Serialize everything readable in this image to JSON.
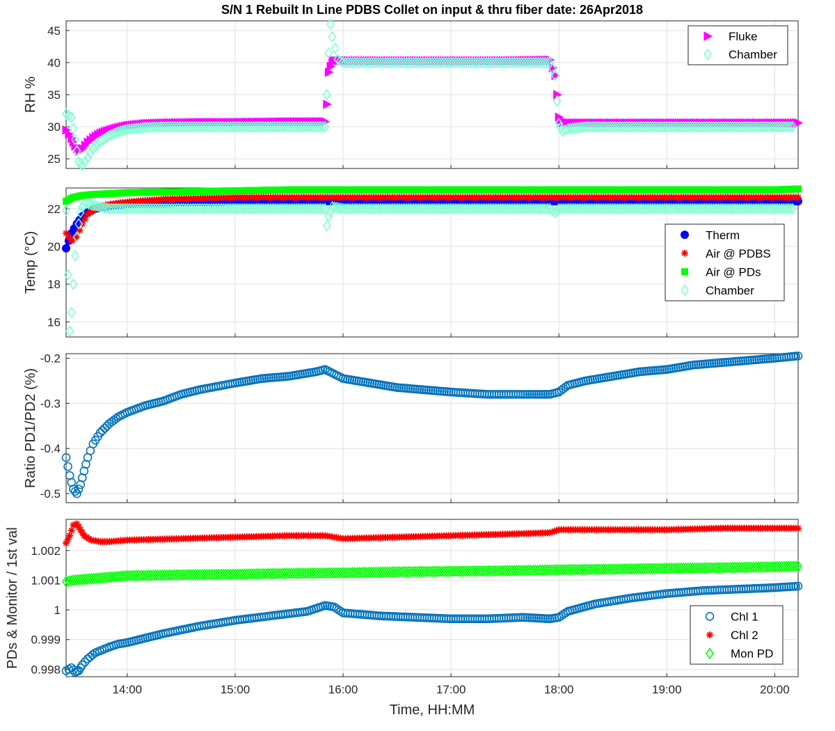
{
  "chart_data": [
    {
      "type": "scatter",
      "title": "S/N 1 Rebuilt In Line PDBS Collet on input & thru fiber date: 26Apr2018",
      "ylabel": "RH %",
      "xlabel": "",
      "xlim": [
        "13:26",
        "20:13"
      ],
      "ylim": [
        23.5,
        46.5
      ],
      "yticks": [
        "25",
        "30",
        "35",
        "40",
        "45"
      ],
      "grid": true,
      "legend": "top-right",
      "series": [
        {
          "name": "Fluke",
          "marker": "triangle-right",
          "color": "#ff00ff",
          "x": [
            "13:26",
            "13:29",
            "13:31",
            "13:33",
            "13:35",
            "13:38",
            "13:41",
            "13:45",
            "13:50",
            "13:55",
            "14:00",
            "14:10",
            "14:20",
            "14:40",
            "15:00",
            "15:30",
            "15:50",
            "15:51",
            "15:52",
            "15:54",
            "16:00",
            "16:30",
            "17:00",
            "17:30",
            "17:55",
            "17:58",
            "17:59",
            "18:00",
            "18:02",
            "18:05",
            "18:15",
            "18:30",
            "19:00",
            "19:30",
            "20:00",
            "20:13"
          ],
          "y": [
            29.5,
            28.2,
            27.0,
            26.2,
            26.6,
            27.6,
            28.3,
            29.0,
            29.5,
            29.9,
            30.2,
            30.5,
            30.6,
            30.7,
            30.7,
            30.8,
            30.8,
            33.5,
            38.5,
            40.3,
            40.3,
            40.3,
            40.3,
            40.3,
            40.4,
            38.0,
            35.0,
            31.5,
            30.7,
            30.6,
            30.6,
            30.6,
            30.6,
            30.6,
            30.6,
            30.6
          ]
        },
        {
          "name": "Chamber",
          "marker": "diamond",
          "color": "#7fffd4",
          "x": [
            "13:26",
            "13:29",
            "13:31",
            "13:33",
            "13:35",
            "13:38",
            "13:41",
            "13:45",
            "13:50",
            "13:55",
            "14:00",
            "14:10",
            "14:20",
            "14:40",
            "15:00",
            "15:30",
            "15:50",
            "15:51",
            "15:52",
            "15:53",
            "15:54",
            "15:57",
            "16:00",
            "16:30",
            "17:00",
            "17:30",
            "17:55",
            "17:58",
            "17:59",
            "18:00",
            "18:02",
            "18:05",
            "18:15",
            "18:30",
            "19:00",
            "19:30",
            "20:00",
            "20:10"
          ],
          "y": [
            32.0,
            31.5,
            28.0,
            24.5,
            24.0,
            25.2,
            26.6,
            27.7,
            28.6,
            29.2,
            29.6,
            29.9,
            30.0,
            30.0,
            30.0,
            30.0,
            30.0,
            35.0,
            41.5,
            46.0,
            44.0,
            40.5,
            40.0,
            40.0,
            40.0,
            40.0,
            40.0,
            38.0,
            34.0,
            30.5,
            29.3,
            29.7,
            30.0,
            30.0,
            30.0,
            30.0,
            30.0,
            30.0
          ]
        }
      ]
    },
    {
      "type": "scatter",
      "title": "",
      "ylabel": "Temp (°C)",
      "xlabel": "",
      "xlim": [
        "13:26",
        "20:13"
      ],
      "ylim": [
        15.2,
        23.1
      ],
      "yticks": [
        "16",
        "18",
        "20",
        "22"
      ],
      "grid": true,
      "legend": "right",
      "series": [
        {
          "name": "Therm",
          "marker": "circle",
          "color": "#0000ff",
          "x": [
            "13:26",
            "13:29",
            "13:32",
            "13:35",
            "13:38",
            "13:42",
            "13:48",
            "13:55",
            "14:05",
            "14:20",
            "15:00",
            "15:50",
            "16:00",
            "17:00",
            "18:00",
            "19:00",
            "20:00",
            "20:13"
          ],
          "y": [
            19.9,
            20.7,
            21.2,
            21.6,
            21.8,
            22.0,
            22.1,
            22.2,
            22.3,
            22.3,
            22.4,
            22.4,
            22.4,
            22.4,
            22.4,
            22.4,
            22.4,
            22.4
          ]
        },
        {
          "name": "Air @ PDBS",
          "marker": "asterisk",
          "color": "#ff0000",
          "x": [
            "13:26",
            "13:29",
            "13:32",
            "13:35",
            "13:38",
            "13:42",
            "13:48",
            "13:55",
            "14:05",
            "14:20",
            "15:00",
            "15:50",
            "16:00",
            "17:00",
            "18:00",
            "19:00",
            "20:00",
            "20:13"
          ],
          "y": [
            20.7,
            20.3,
            20.5,
            21.2,
            21.7,
            22.0,
            22.2,
            22.3,
            22.4,
            22.5,
            22.6,
            22.6,
            22.6,
            22.6,
            22.6,
            22.6,
            22.6,
            22.6
          ]
        },
        {
          "name": "Air @ PDs",
          "marker": "square",
          "color": "#00ff00",
          "x": [
            "13:26",
            "13:30",
            "13:35",
            "13:40",
            "13:50",
            "14:00",
            "14:30",
            "15:00",
            "15:30",
            "16:00",
            "17:00",
            "18:00",
            "19:00",
            "20:00",
            "20:13"
          ],
          "y": [
            22.4,
            22.6,
            22.7,
            22.75,
            22.8,
            22.85,
            22.9,
            22.95,
            23.0,
            23.0,
            23.0,
            23.0,
            23.0,
            23.0,
            23.05
          ]
        },
        {
          "name": "Chamber",
          "marker": "diamond",
          "color": "#7fffd4",
          "x": [
            "13:26",
            "13:27",
            "13:28",
            "13:29",
            "13:30",
            "13:31",
            "13:32",
            "13:33",
            "13:34",
            "13:35",
            "13:37",
            "13:40",
            "13:45",
            "13:50",
            "14:00",
            "15:00",
            "15:50",
            "15:51",
            "15:52",
            "15:54",
            "16:00",
            "17:00",
            "17:55",
            "17:58",
            "18:00",
            "19:00",
            "20:00",
            "20:10"
          ],
          "y": [
            21.9,
            18.5,
            15.5,
            16.5,
            18.0,
            19.5,
            20.5,
            21.2,
            21.8,
            22.1,
            22.3,
            22.2,
            22.1,
            22.0,
            22.0,
            22.0,
            22.0,
            21.1,
            21.6,
            22.1,
            22.0,
            22.0,
            22.0,
            21.8,
            22.0,
            22.0,
            22.0,
            22.0
          ]
        }
      ]
    },
    {
      "type": "scatter",
      "title": "",
      "ylabel": "Ratio PD1/PD2 (%)",
      "xlabel": "",
      "xlim": [
        "13:26",
        "20:13"
      ],
      "ylim": [
        -0.52,
        -0.19
      ],
      "yticks": [
        "-0.5",
        "-0.4",
        "-0.3",
        "-0.2"
      ],
      "grid": true,
      "legend": "none",
      "series": [
        {
          "name": "",
          "marker": "circle",
          "color": "#0072bd",
          "x": [
            "13:26",
            "13:28",
            "13:30",
            "13:32",
            "13:34",
            "13:36",
            "13:38",
            "13:41",
            "13:45",
            "13:50",
            "13:55",
            "14:00",
            "14:10",
            "14:20",
            "14:30",
            "14:40",
            "15:00",
            "15:15",
            "15:30",
            "15:45",
            "15:50",
            "15:55",
            "16:00",
            "16:15",
            "16:30",
            "16:45",
            "17:00",
            "17:20",
            "17:40",
            "17:55",
            "18:00",
            "18:05",
            "18:15",
            "18:30",
            "18:45",
            "19:00",
            "19:15",
            "19:30",
            "19:45",
            "20:00",
            "20:13"
          ],
          "y": [
            -0.42,
            -0.46,
            -0.49,
            -0.5,
            -0.48,
            -0.45,
            -0.42,
            -0.39,
            -0.365,
            -0.345,
            -0.33,
            -0.32,
            -0.305,
            -0.295,
            -0.28,
            -0.27,
            -0.255,
            -0.245,
            -0.24,
            -0.23,
            -0.225,
            -0.235,
            -0.245,
            -0.255,
            -0.265,
            -0.27,
            -0.275,
            -0.28,
            -0.28,
            -0.28,
            -0.275,
            -0.26,
            -0.25,
            -0.24,
            -0.23,
            -0.225,
            -0.215,
            -0.21,
            -0.205,
            -0.2,
            -0.195
          ]
        }
      ]
    },
    {
      "type": "scatter",
      "title": "",
      "ylabel": "PDs & Monitor / 1st val",
      "xlabel": "Time, HH:MM",
      "xlim": [
        "13:26",
        "20:13"
      ],
      "ylim": [
        0.99775,
        1.00305
      ],
      "yticks": [
        "0.998",
        "0.999",
        "1",
        "1.001",
        "1.002"
      ],
      "xticks": [
        "14:00",
        "15:00",
        "16:00",
        "17:00",
        "18:00",
        "19:00",
        "20:00"
      ],
      "grid": true,
      "legend": "bottom-right",
      "series": [
        {
          "name": "Chl 1",
          "marker": "circle",
          "color": "#0072bd",
          "x": [
            "13:26",
            "13:29",
            "13:31",
            "13:33",
            "13:35",
            "13:38",
            "13:42",
            "13:46",
            "13:50",
            "13:55",
            "14:00",
            "14:10",
            "14:20",
            "14:40",
            "15:00",
            "15:20",
            "15:40",
            "15:50",
            "15:55",
            "16:00",
            "16:20",
            "16:40",
            "17:00",
            "17:20",
            "17:40",
            "17:55",
            "18:00",
            "18:05",
            "18:20",
            "18:40",
            "19:00",
            "19:20",
            "19:40",
            "20:00",
            "20:13"
          ],
          "y": [
            0.99795,
            0.99805,
            0.9979,
            0.99795,
            0.99815,
            0.99835,
            0.99855,
            0.99865,
            0.99875,
            0.99885,
            0.9989,
            0.99905,
            0.9992,
            0.99945,
            0.99965,
            0.9998,
            0.99995,
            1.00015,
            1.0001,
            0.9999,
            0.9998,
            0.99975,
            0.9997,
            0.9997,
            0.99975,
            0.9997,
            0.99975,
            0.99995,
            1.0002,
            1.0004,
            1.00055,
            1.00065,
            1.0007,
            1.00075,
            1.0008
          ]
        },
        {
          "name": "Chl 2",
          "marker": "asterisk",
          "color": "#ff0000",
          "x": [
            "13:26",
            "13:28",
            "13:30",
            "13:32",
            "13:34",
            "13:36",
            "13:40",
            "13:45",
            "13:50",
            "14:00",
            "14:30",
            "15:00",
            "15:30",
            "15:50",
            "16:00",
            "16:30",
            "17:00",
            "17:30",
            "17:55",
            "18:00",
            "18:30",
            "19:00",
            "19:30",
            "20:00",
            "20:13"
          ],
          "y": [
            1.00225,
            1.0025,
            1.00285,
            1.0029,
            1.0027,
            1.0025,
            1.00235,
            1.0023,
            1.0023,
            1.00235,
            1.0024,
            1.00245,
            1.0025,
            1.0025,
            1.0024,
            1.00245,
            1.0025,
            1.00255,
            1.0026,
            1.0027,
            1.0027,
            1.0027,
            1.00275,
            1.00275,
            1.00275
          ]
        },
        {
          "name": "Mon PD",
          "marker": "diamond",
          "color": "#00ff00",
          "x": [
            "13:26",
            "13:30",
            "13:40",
            "13:50",
            "14:00",
            "14:30",
            "15:00",
            "15:30",
            "16:00",
            "16:30",
            "17:00",
            "17:30",
            "18:00",
            "18:30",
            "19:00",
            "19:30",
            "20:00",
            "20:13"
          ],
          "y": [
            1.00095,
            1.001,
            1.00105,
            1.0011,
            1.00115,
            1.00118,
            1.0012,
            1.00123,
            1.00125,
            1.00128,
            1.0013,
            1.00132,
            1.00135,
            1.00137,
            1.0014,
            1.00142,
            1.00145,
            1.00147
          ]
        }
      ]
    }
  ]
}
